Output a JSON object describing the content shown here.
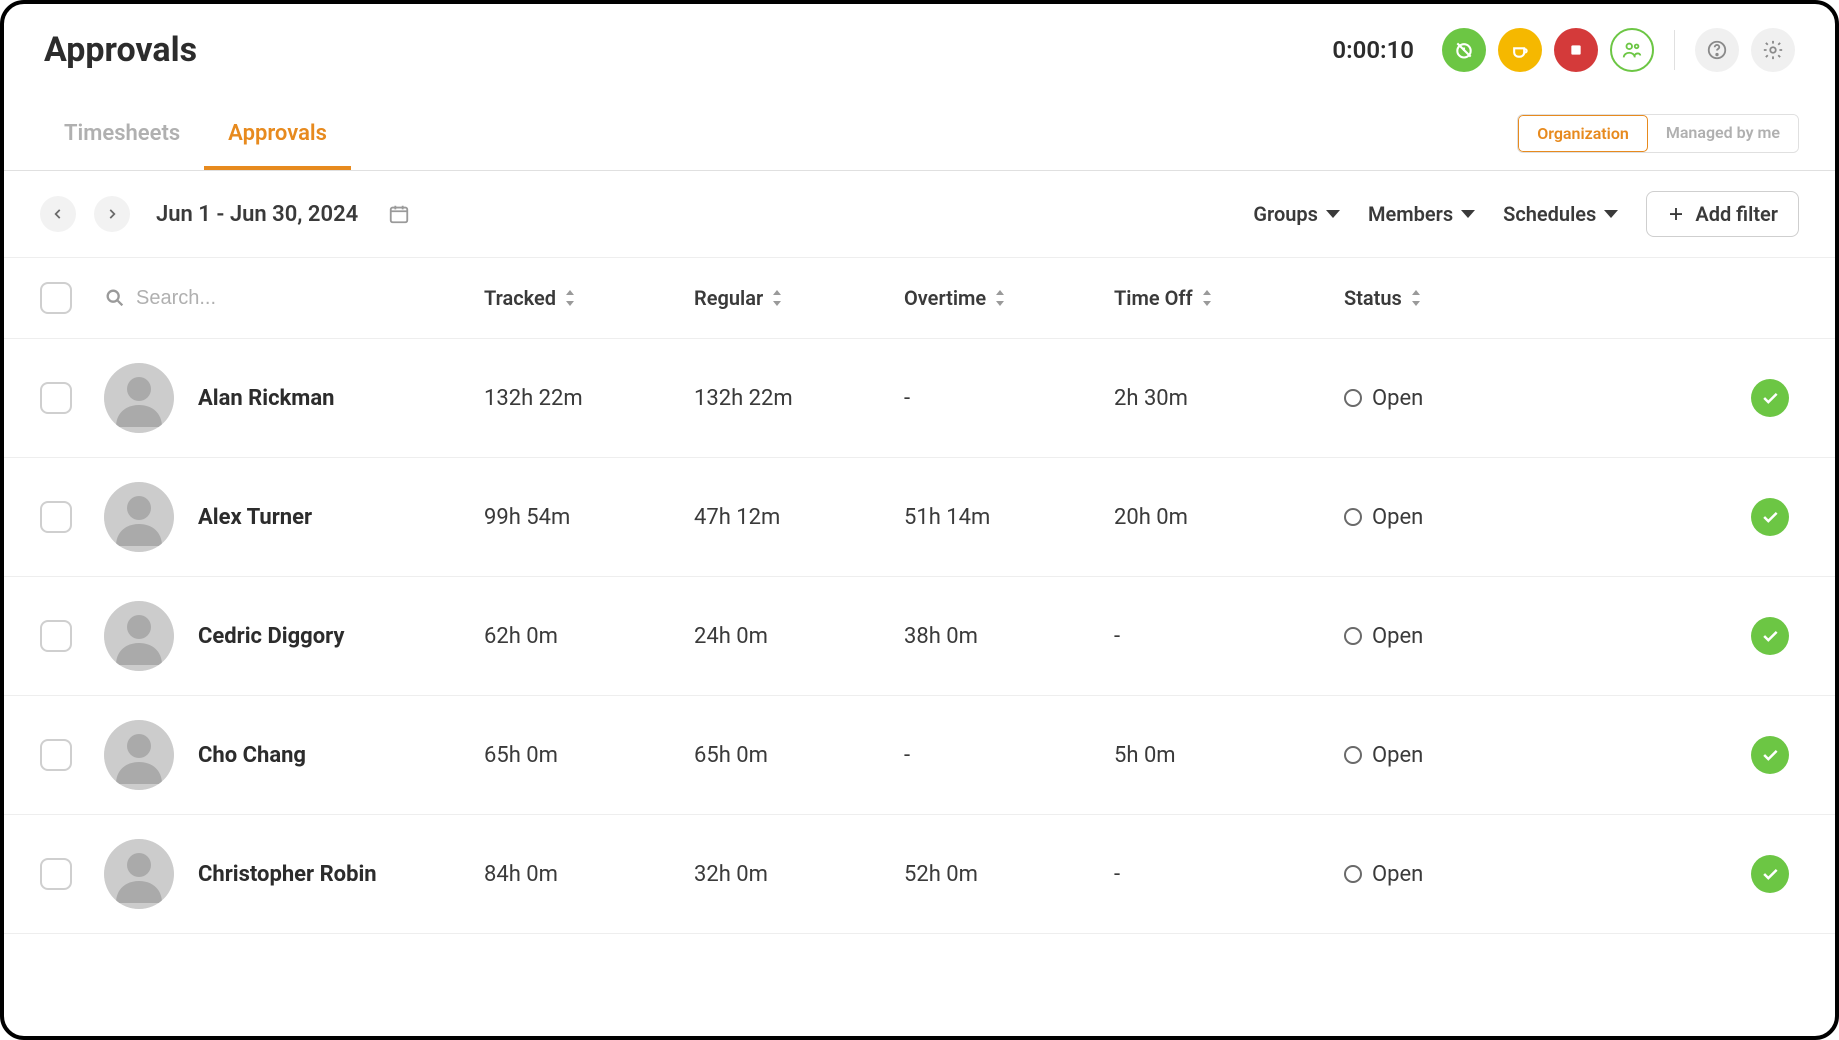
{
  "header": {
    "title": "Approvals",
    "timer": "0:00:10"
  },
  "tabs": {
    "timesheets": "Timesheets",
    "approvals": "Approvals"
  },
  "scope": {
    "organization": "Organization",
    "managed": "Managed by me"
  },
  "filters": {
    "date_range": "Jun 1 - Jun 30, 2024",
    "groups": "Groups",
    "members": "Members",
    "schedules": "Schedules",
    "add_filter": "Add filter",
    "search_placeholder": "Search..."
  },
  "columns": {
    "tracked": "Tracked",
    "regular": "Regular",
    "overtime": "Overtime",
    "timeoff": "Time Off",
    "status": "Status"
  },
  "rows": [
    {
      "name": "Alan Rickman",
      "tracked": "132h 22m",
      "regular": "132h 22m",
      "overtime": "-",
      "timeoff": "2h 30m",
      "status": "Open"
    },
    {
      "name": "Alex Turner",
      "tracked": "99h 54m",
      "regular": "47h 12m",
      "overtime": "51h 14m",
      "timeoff": "20h 0m",
      "status": "Open"
    },
    {
      "name": "Cedric Diggory",
      "tracked": "62h 0m",
      "regular": "24h 0m",
      "overtime": "38h 0m",
      "timeoff": "-",
      "status": "Open"
    },
    {
      "name": "Cho Chang",
      "tracked": "65h 0m",
      "regular": "65h 0m",
      "overtime": "-",
      "timeoff": "5h 0m",
      "status": "Open"
    },
    {
      "name": "Christopher Robin",
      "tracked": "84h 0m",
      "regular": "32h 0m",
      "overtime": "52h 0m",
      "timeoff": "-",
      "status": "Open"
    }
  ]
}
